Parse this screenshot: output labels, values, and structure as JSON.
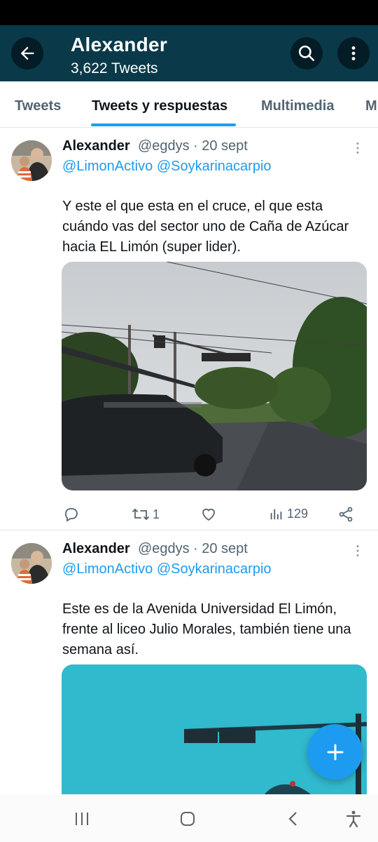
{
  "header": {
    "title": "Alexander",
    "subtitle": "3,622 Tweets",
    "back_icon": "arrow-left-icon",
    "search_icon": "search-icon",
    "more_icon": "more-vertical-icon",
    "color": "#0a3a4a"
  },
  "tabs": [
    {
      "label": "Tweets",
      "active": false
    },
    {
      "label": "Tweets y respuestas",
      "active": true
    },
    {
      "label": "Multimedia",
      "active": false
    },
    {
      "label": "M",
      "active": false
    }
  ],
  "tweets": [
    {
      "name": "Alexander",
      "handle": "@egdys",
      "date": "· 20 sept",
      "mentions": [
        "@LimonActivo",
        "@Soykarinacarpio"
      ],
      "text": "Y este el que esta en el cruce,  el que esta cuándo vas del sector uno de Caña de Azúcar hacia EL Limón (super lider).",
      "actions": {
        "replies": "",
        "retweets": "1",
        "likes": "",
        "views": "129"
      }
    },
    {
      "name": "Alexander",
      "handle": "@egdys",
      "date": "· 20 sept",
      "mentions": [
        "@LimonActivo",
        "@Soykarinacarpio"
      ],
      "text": "Este es de la Avenida Universidad El Limón, frente al liceo Julio Morales, también tiene una semana así."
    }
  ],
  "fab": {
    "icon": "plus-icon",
    "color": "#1d9bf0"
  },
  "navbar": {
    "icons": [
      "recent-apps-icon",
      "home-icon",
      "back-icon",
      "accessibility-icon"
    ]
  }
}
